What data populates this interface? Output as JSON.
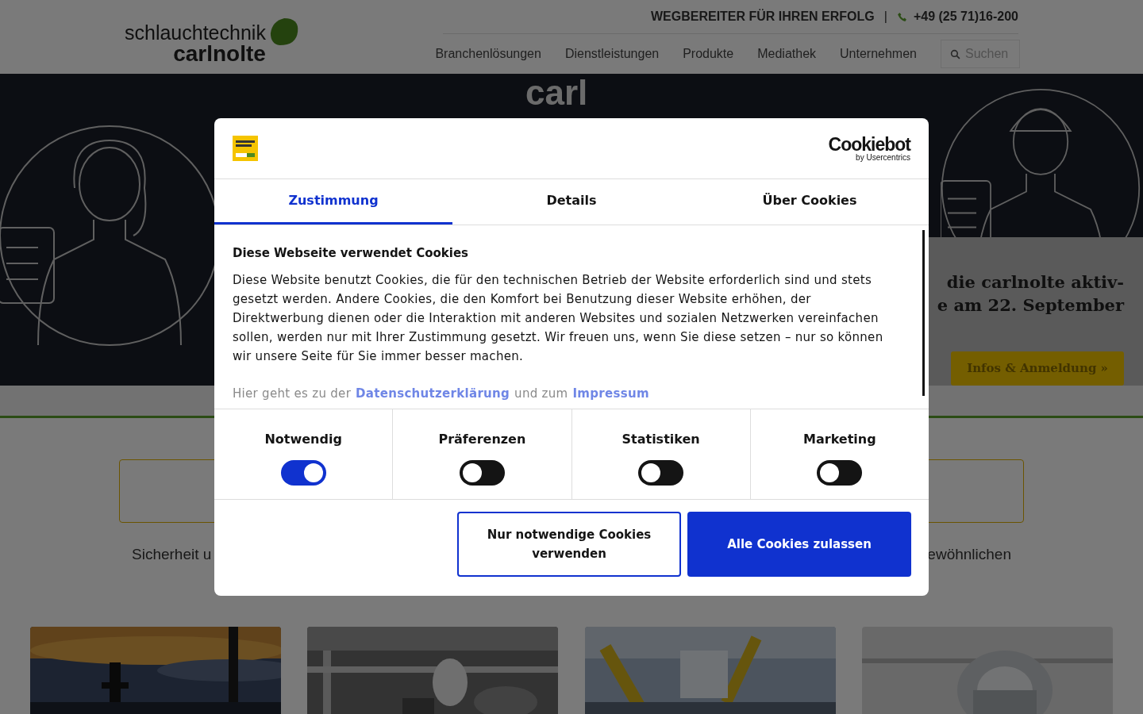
{
  "header": {
    "logo_top": "schlauchtechnik",
    "logo_bottom": "carlnolte",
    "tagline": "WEGBEREITER FÜR IHREN ERFOLG",
    "separator": "|",
    "phone": "+49 (25 71)16-200",
    "nav": [
      {
        "label": "Branchenlösungen"
      },
      {
        "label": "Dienstleistungen"
      },
      {
        "label": "Produkte"
      },
      {
        "label": "Mediathek"
      },
      {
        "label": "Unternehmen"
      }
    ],
    "search": {
      "placeholder": "Suchen"
    }
  },
  "hero": {
    "logo_text": "carl",
    "headline": [
      "die carlnolte aktiv-",
      "e am 22. September"
    ],
    "button": "Infos & Anmeldung »"
  },
  "intro": {
    "text_left": "Sicherheit u",
    "text_right": "ewöhnlichen"
  },
  "cards": [
    {
      "kind": "refinery"
    },
    {
      "kind": "lab"
    },
    {
      "kind": "robot"
    },
    {
      "kind": "hose"
    }
  ],
  "cookie_dialog": {
    "brand": "Cookiebot",
    "brand_sub": "by Usercentrics",
    "tabs": [
      {
        "label": "Zustimmung",
        "selected": true
      },
      {
        "label": "Details",
        "selected": false
      },
      {
        "label": "Über Cookies",
        "selected": false
      }
    ],
    "heading": "Diese Webseite verwendet Cookies",
    "body": "Diese Website benutzt Cookies, die für den technischen Betrieb der Website erforderlich sind und stets gesetzt werden. Andere Cookies, die den Komfort bei Benutzung dieser Website erhöhen, der Direktwerbung dienen oder die Interaktion mit anderen Websites und sozialen Netzwerken vereinfachen sollen, werden nur mit Ihrer Zustimmung gesetzt. Wir freuen uns, wenn Sie diese setzen – nur so können wir unsere Seite für Sie immer besser machen.",
    "links_line": {
      "before": "Hier geht es zu der",
      "link_1": "Datenschutzerklärung",
      "middle": "und zum",
      "link_2": "Impressum"
    },
    "categories": [
      {
        "label": "Notwendig",
        "checked": true
      },
      {
        "label": "Präferenzen",
        "checked": false
      },
      {
        "label": "Statistiken",
        "checked": false
      },
      {
        "label": "Marketing",
        "checked": false
      }
    ],
    "buttons": [
      {
        "label": "Nur notwendige Cookies verwenden",
        "kind": "outline"
      },
      {
        "label": "Alle Cookies zulassen",
        "kind": "primary"
      }
    ]
  }
}
